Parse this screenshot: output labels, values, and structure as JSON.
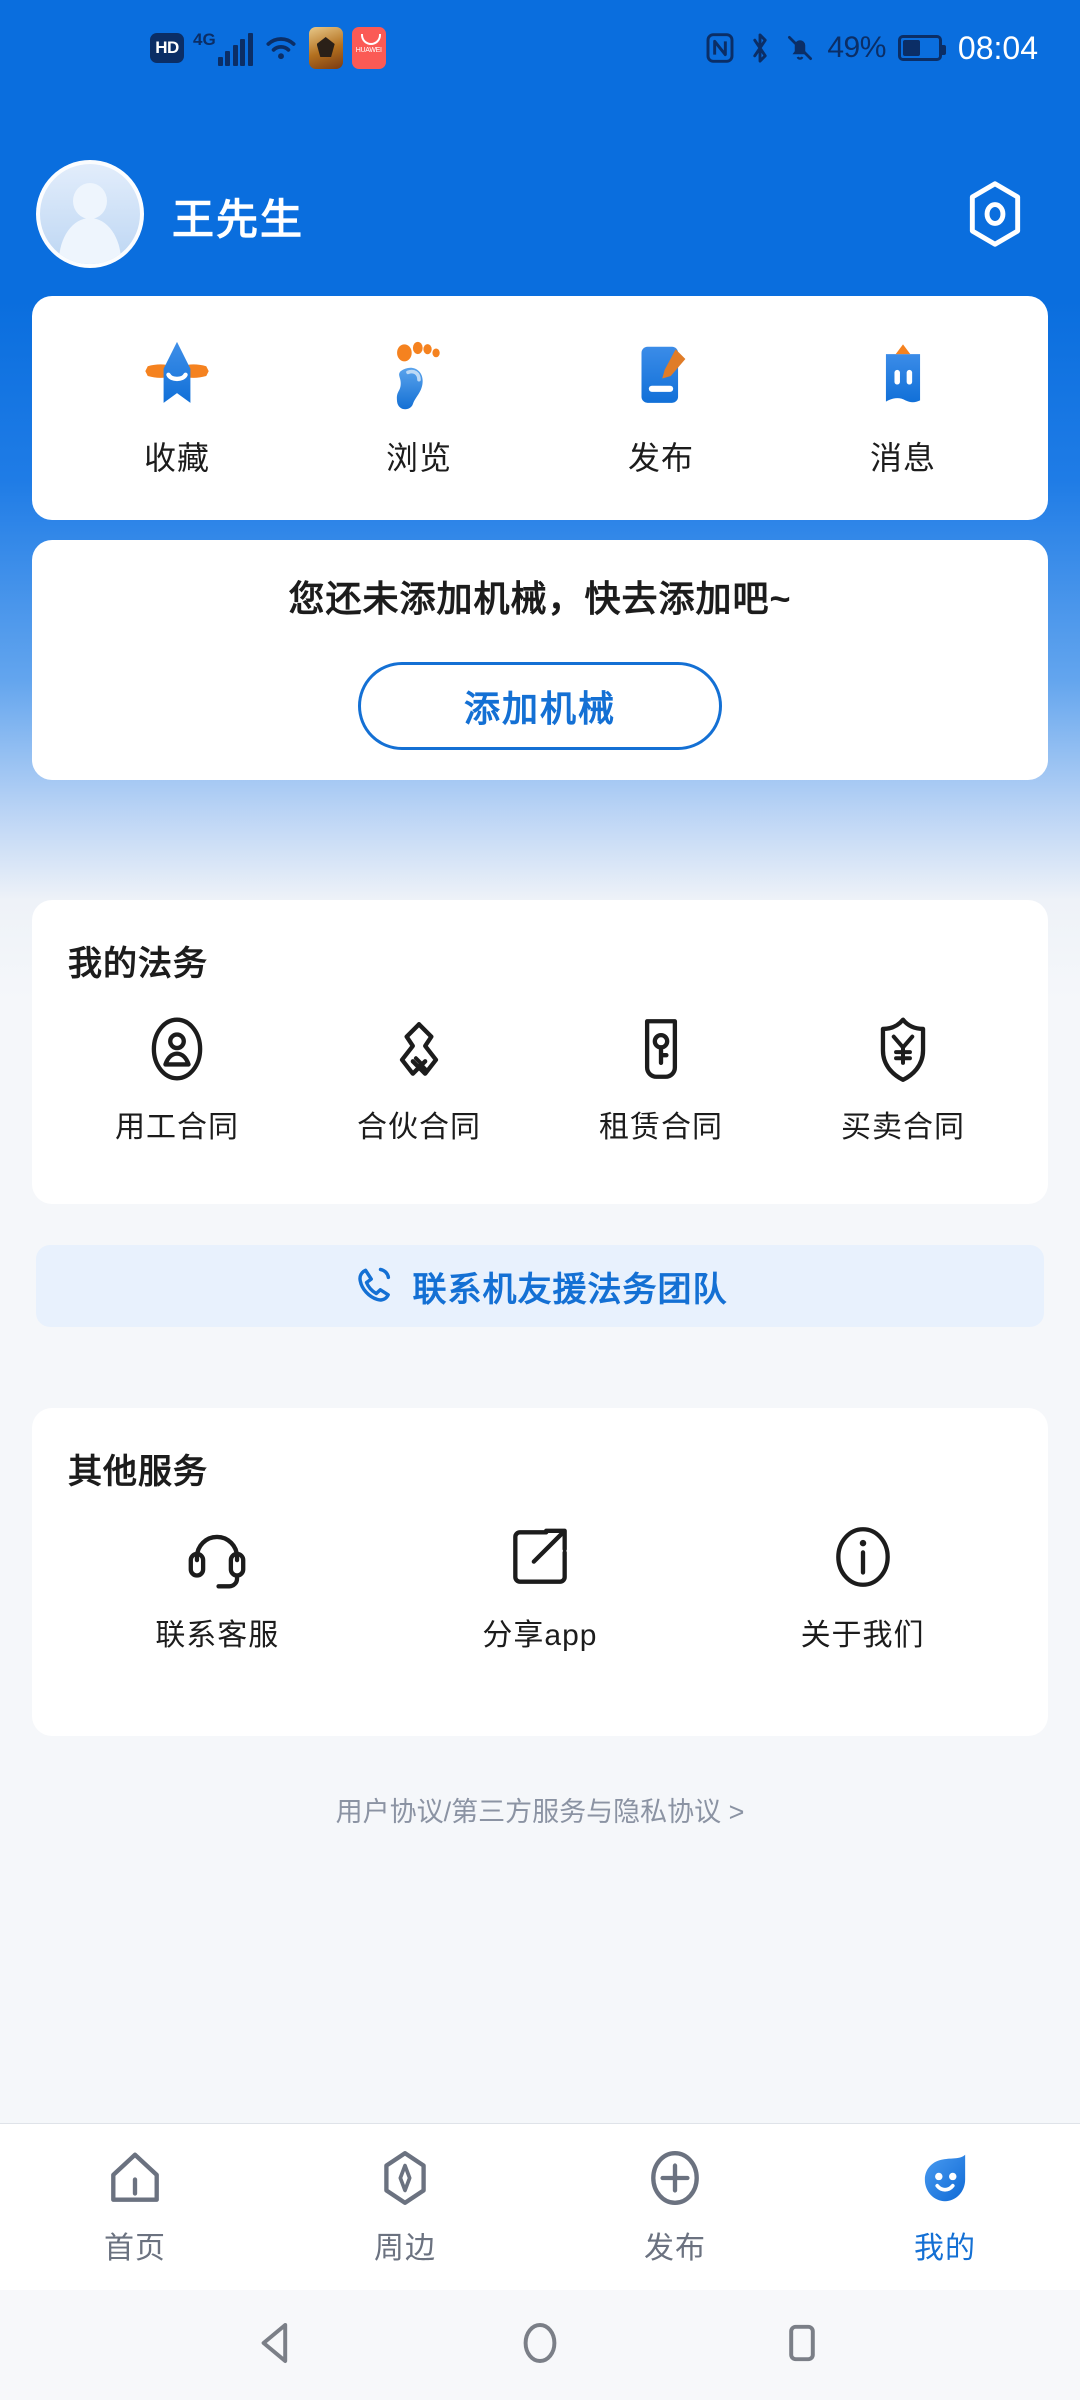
{
  "status_bar": {
    "hd_label": "HD",
    "network_label": "4G",
    "icons": [
      "hd-badge",
      "signal-bars-icon",
      "wifi-icon",
      "app-badge-game",
      "app-badge-huawei",
      "nfc-icon",
      "bluetooth-icon",
      "mute-bell-icon"
    ],
    "battery_percent": "49%",
    "time": "08:04"
  },
  "header": {
    "username": "王先生",
    "avatar_name": "default-user-avatar",
    "settings_icon": "hex-settings-icon"
  },
  "quick_actions": [
    {
      "label": "收藏",
      "icon": "star-icon"
    },
    {
      "label": "浏览",
      "icon": "footprint-icon"
    },
    {
      "label": "发布",
      "icon": "document-pen-icon"
    },
    {
      "label": "消息",
      "icon": "mailbox-icon"
    }
  ],
  "machinery": {
    "empty_text": "您还未添加机械，快去添加吧~",
    "add_button": "添加机械"
  },
  "legal": {
    "title": "我的法务",
    "items": [
      {
        "label": "用工合同",
        "icon": "person-badge-icon"
      },
      {
        "label": "合伙合同",
        "icon": "handshake-icon"
      },
      {
        "label": "租赁合同",
        "icon": "key-card-icon"
      },
      {
        "label": "买卖合同",
        "icon": "shield-yuan-icon"
      }
    ],
    "cta_label": "联系机友援法务团队",
    "cta_icon": "phone-icon"
  },
  "other_services": {
    "title": "其他服务",
    "items": [
      {
        "label": "联系客服",
        "icon": "headset-icon"
      },
      {
        "label": "分享app",
        "icon": "share-external-icon"
      },
      {
        "label": "关于我们",
        "icon": "info-circle-icon"
      }
    ]
  },
  "agreement_link": "用户协议/第三方服务与隐私协议 >",
  "tab_bar": [
    {
      "label": "首页",
      "icon": "home-icon",
      "active": false
    },
    {
      "label": "周边",
      "icon": "compass-icon",
      "active": false
    },
    {
      "label": "发布",
      "icon": "plus-circle-icon",
      "active": false
    },
    {
      "label": "我的",
      "icon": "smiley-face-icon",
      "active": true
    }
  ],
  "android_nav": [
    "back-icon",
    "home-circle-icon",
    "recents-square-icon"
  ],
  "colors": {
    "brand_blue": "#1470d4",
    "header_blue": "#0a6ede",
    "page_bg": "#f5f7fa",
    "card_bg": "#ffffff",
    "cta_bg": "#e8f1fd",
    "muted_text": "#8b93a3"
  }
}
